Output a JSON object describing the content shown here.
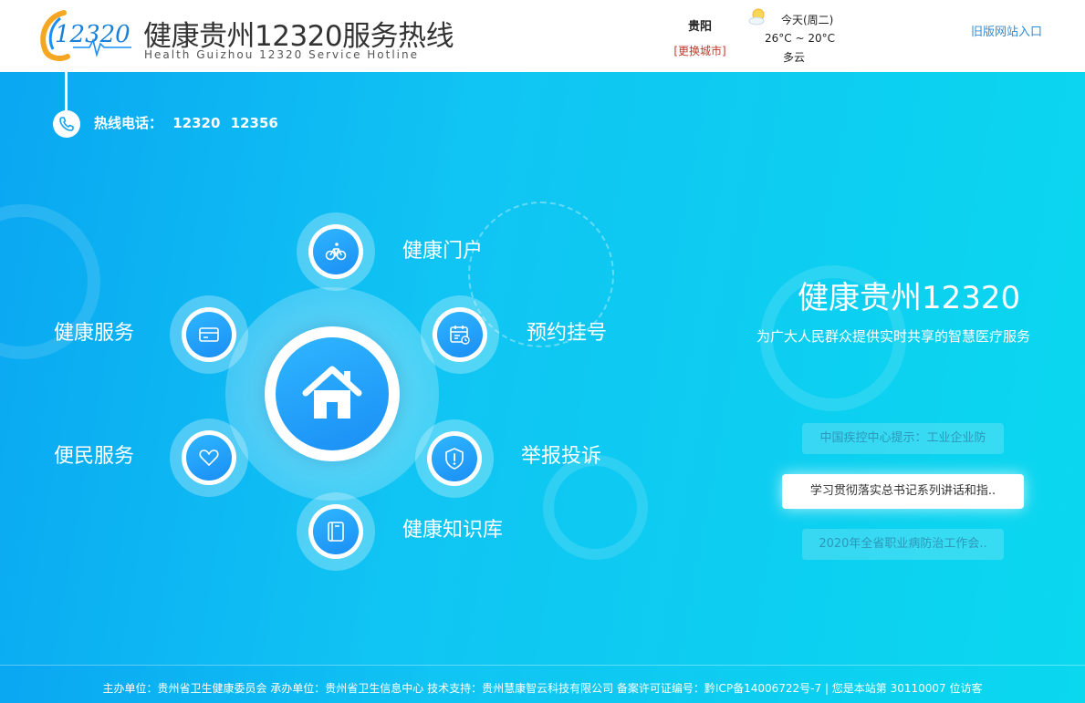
{
  "header": {
    "logo_text": "12320",
    "site_title": "健康贵州12320服务热线",
    "site_subtitle": "Health Guizhou 12320 Service Hotline",
    "city": {
      "name": "贵阳",
      "change_label": "[更换城市]"
    },
    "weather": {
      "day": "今天(周二)",
      "temp": "26°C ~ 20°C",
      "desc": "多云",
      "icon": "sun-cloud-icon"
    },
    "old_site_label": "旧版网站入口"
  },
  "hotline": {
    "label": "热线电话：",
    "numbers": [
      "12320",
      "12356"
    ]
  },
  "services": {
    "portal": "健康门户",
    "appointment": "预约挂号",
    "complaint": "举报投诉",
    "knowledge": "健康知识库",
    "convenience": "便民服务",
    "health_service": "健康服务"
  },
  "brand": {
    "title": "健康贵州12320",
    "slogan": "为广大人民群众提供实时共享的智慧医疗服务"
  },
  "notices": [
    "中国疾控中心提示：工业企业防",
    "学习贯彻落实总书记系列讲话和指..",
    "2020年全省职业病防治工作会.."
  ],
  "footer": {
    "text": "主办单位：贵州省卫生健康委员会  承办单位：贵州省卫生信息中心  技术支持：贵州慧康智云科技有限公司  备案许可证编号：黔ICP备14006722号-7 | 您是本站第 30110007 位访客"
  },
  "colors": {
    "primary_blue": "#1a8ef5",
    "bg_start": "#0aa7f2",
    "bg_end": "#0ad8ef",
    "city_link": "#c0392b",
    "old_site_link": "#2d8cd8"
  }
}
